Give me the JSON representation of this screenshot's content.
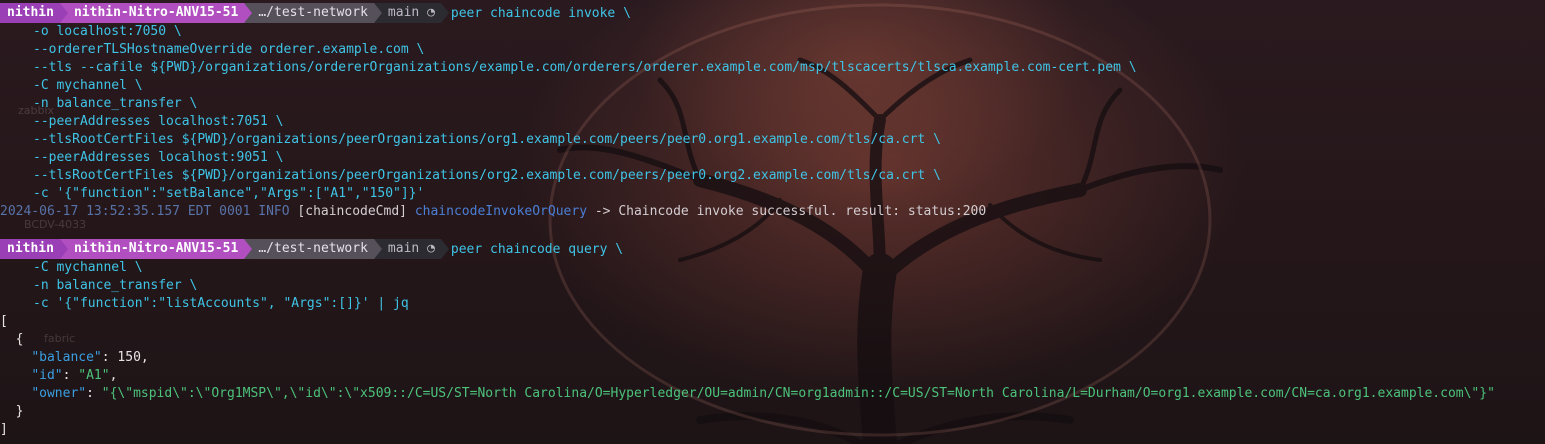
{
  "prompt": {
    "user": "nithin",
    "host": "nithin-Nitro-ANV15-51",
    "path": "…/test-network",
    "git_branch": "main",
    "git_icon": "◔"
  },
  "desktop_labels": [
    "zabbix",
    "BCDV-4033",
    "fabric"
  ],
  "command1": {
    "first": "peer chaincode invoke \\",
    "lines": [
      "-o localhost:7050 \\",
      "--ordererTLSHostnameOverride orderer.example.com \\",
      "--tls --cafile ${PWD}/organizations/ordererOrganizations/example.com/orderers/orderer.example.com/msp/tlscacerts/tlsca.example.com-cert.pem \\",
      "-C mychannel \\",
      "-n balance_transfer \\",
      "--peerAddresses localhost:7051 \\",
      "--tlsRootCertFiles ${PWD}/organizations/peerOrganizations/org1.example.com/peers/peer0.org1.example.com/tls/ca.crt \\",
      "--peerAddresses localhost:9051 \\",
      "--tlsRootCertFiles ${PWD}/organizations/peerOrganizations/org2.example.com/peers/peer0.org2.example.com/tls/ca.crt \\",
      "-c '{\"function\":\"setBalance\",\"Args\":[\"A1\",\"150\"]}'"
    ]
  },
  "log": {
    "timestamp": "2024-06-17 13:52:35.157 EDT 0001 INFO",
    "tag": " [chaincodeCmd] ",
    "function": "chaincodeInvokeOrQuery",
    "message": " -> Chaincode invoke successful. result: status:200"
  },
  "command2": {
    "first": "peer chaincode query \\",
    "lines": [
      "-C mychannel \\",
      "-n balance_transfer \\",
      "-c '{\"function\":\"listAccounts\", \"Args\":[]}' | jq"
    ]
  },
  "output": {
    "open_bracket": "[",
    "open_brace": "  {",
    "balance_key": "\"balance\"",
    "balance_value": "150",
    "id_key": "\"id\"",
    "id_value": "\"A1\"",
    "owner_key": "\"owner\"",
    "owner_value": "\"{\\\"mspid\\\":\\\"Org1MSP\\\",\\\"id\\\":\\\"x509::/C=US/ST=North Carolina/O=Hyperledger/OU=admin/CN=org1admin::/C=US/ST=North Carolina/L=Durham/O=org1.example.com/CN=ca.org1.example.com\\\"}\"",
    "close_brace": "  }",
    "close_bracket": "]"
  },
  "colors": {
    "command": "#3fc4e6",
    "prompt_user_bg": "#9a3fb5",
    "prompt_host_bg": "#b14fc0",
    "json_key": "#3a9fe0",
    "json_string": "#4cc27a"
  }
}
